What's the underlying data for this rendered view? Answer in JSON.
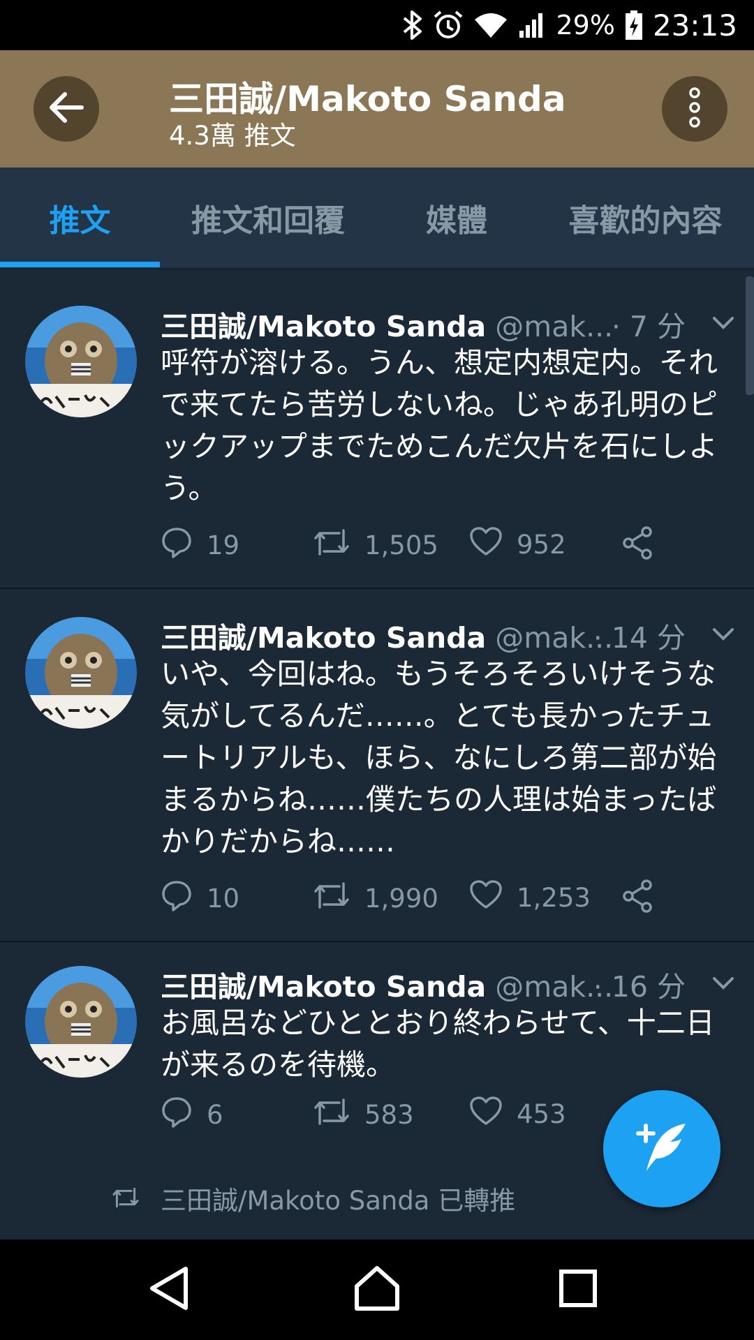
{
  "status_bar": {
    "battery": "29%",
    "time": "23:13",
    "icons": [
      "bluetooth-icon",
      "alarm-icon",
      "wifi-icon",
      "cell-signal-icon",
      "battery-charging-icon"
    ]
  },
  "header": {
    "title": "三田誠/Makoto Sanda",
    "subtitle": "4.3萬 推文",
    "back_icon": "arrow-left-icon",
    "more_icon": "more-vertical-icon"
  },
  "tabs": [
    {
      "label": "推文",
      "active": true
    },
    {
      "label": "推文和回覆",
      "active": false
    },
    {
      "label": "媒體",
      "active": false
    },
    {
      "label": "喜歡的內容",
      "active": false
    }
  ],
  "tweets": [
    {
      "name": "三田誠/Makoto Sanda",
      "handle": "@mak...",
      "time": "· 7 分",
      "text": "呼符が溶ける。うん、想定内想定内。それで来てたら苦労しないね。じゃあ孔明のピックアップまでためこんだ欠片を石にしよう。",
      "replies": "19",
      "retweets": "1,505",
      "likes": "952"
    },
    {
      "name": "三田誠/Makoto Sanda",
      "handle": "@mak...",
      "time": "· 14 分",
      "text": "いや、今回はね。もうそろそろいけそうな気がしてるんだ……。とても長かったチュートリアルも、ほら、なにしろ第二部が始まるからね……僕たちの人理は始まったばかりだからね……",
      "replies": "10",
      "retweets": "1,990",
      "likes": "1,253"
    },
    {
      "name": "三田誠/Makoto Sanda",
      "handle": "@mak...",
      "time": "· 16 分",
      "text": "お風呂などひととおり終わらせて、十二日が来るのを待機。",
      "replies": "6",
      "retweets": "583",
      "likes": "453"
    }
  ],
  "retweet_note": "三田誠/Makoto Sanda 已轉推",
  "colors": {
    "header_bg": "#8b7755",
    "tab_bar_bg": "#243447",
    "feed_bg": "#1b2836",
    "accent": "#1da1f2",
    "muted_text": "#8899a6"
  }
}
